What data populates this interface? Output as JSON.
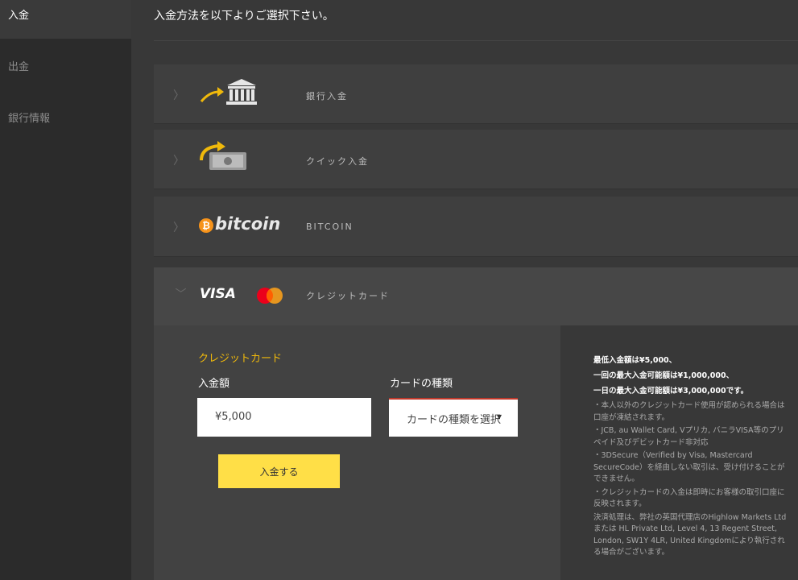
{
  "sidebar": {
    "items": [
      {
        "label": "入金",
        "active": true
      },
      {
        "label": "出金",
        "active": false
      },
      {
        "label": "銀行情報",
        "active": false
      }
    ]
  },
  "main": {
    "headline": "入金方法を以下よりご選択下さい。",
    "methods": [
      {
        "label": "銀行入金",
        "icon": "bank-icon"
      },
      {
        "label": "クイック入金",
        "icon": "quick-money-icon"
      },
      {
        "label": "BITCOIN",
        "icon": "bitcoin-logo",
        "logo_text": "bitcoin"
      },
      {
        "label": "クレジットカード",
        "icon": "visa-mastercard-logo",
        "logo_text": "VISA"
      }
    ]
  },
  "credit_form": {
    "title": "クレジットカード",
    "amount_label": "入金額",
    "amount_value": "¥5,000",
    "card_type_label": "カードの種類",
    "card_type_select": "カードの種類を選択",
    "submit": "入金する"
  },
  "info": {
    "lines_bold": [
      "最低入金額は¥5,000、",
      "一回の最大入金可能額は¥1,000,000、",
      "一日の最大入金可能額は¥3,000,000です。"
    ],
    "notes": [
      "・本人以外のクレジットカード使用が認められる場合は口座が凍結されます。",
      "・JCB, au Wallet Card, Vプリカ, バニラVISA等のプリペイド及びデビットカード非対応",
      "・3DSecure（Verified by Visa, Mastercard SecureCode）を経由しない取引は、受け付けることができません。",
      "・クレジットカードの入金は即時にお客様の取引口座に反映されます。",
      "決済処理は、弊社の英国代理店のHighlow Markets Ltd または HL Private Ltd, Level 4, 13 Regent Street, London, SW1Y 4LR, United Kingdomにより執行される場合がございます。"
    ]
  },
  "colors": {
    "accent": "#f0b90b",
    "button": "#ffdf47",
    "bitcoin": "#f7931a"
  }
}
